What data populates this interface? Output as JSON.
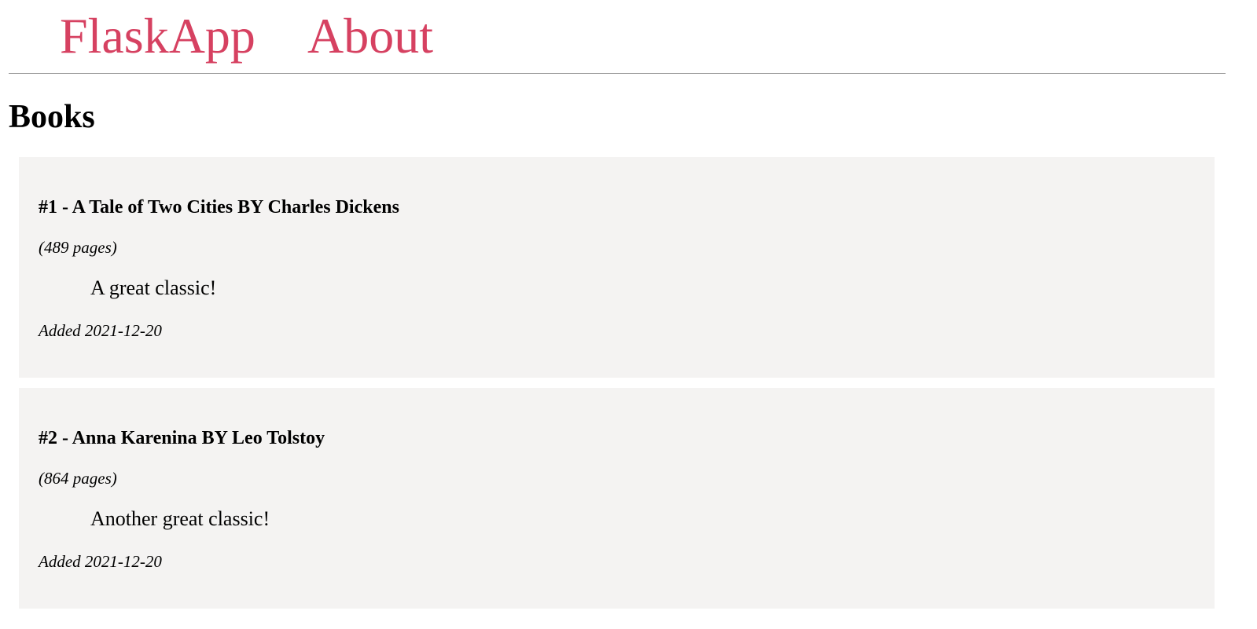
{
  "nav": {
    "brand": "FlaskApp",
    "about": "About",
    "link_color": "#d64161"
  },
  "page": {
    "title": "Books"
  },
  "books": [
    {
      "heading": "#1 - A Tale of Two Cities BY Charles Dickens",
      "pages": "(489 pages)",
      "review": "A great classic!",
      "added": "Added 2021-12-20"
    },
    {
      "heading": "#2 - Anna Karenina BY Leo Tolstoy",
      "pages": "(864 pages)",
      "review": "Another great classic!",
      "added": "Added 2021-12-20"
    }
  ],
  "colors": {
    "card_background": "#f4f3f2",
    "divider": "#9a9a9a"
  }
}
